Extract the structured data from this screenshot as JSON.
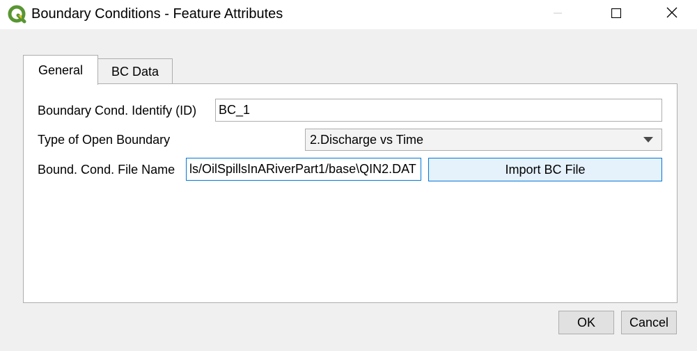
{
  "window": {
    "title": "Boundary Conditions - Feature Attributes",
    "app_icon": "qgis-logo-icon",
    "controls": [
      "minimize-icon",
      "maximize-icon",
      "close-icon"
    ]
  },
  "tabs": [
    {
      "label": "General",
      "selected": true
    },
    {
      "label": "BC Data",
      "selected": false
    }
  ],
  "form": {
    "id_label": "Boundary Cond. Identify (ID)",
    "id_value": "BC_1",
    "type_label": "Type of Open Boundary",
    "type_value": "2.Discharge vs Time",
    "file_label": "Bound. Cond. File Name",
    "file_value": "ls/OilSpillsInARiverPart1/base\\QIN2.DAT",
    "import_button": "Import BC File"
  },
  "buttons": {
    "ok": "OK",
    "cancel": "Cancel"
  },
  "colors": {
    "focus_accent": "#0078d7",
    "qgis_green": "#589632",
    "qgis_yellow": "#ee7913"
  }
}
